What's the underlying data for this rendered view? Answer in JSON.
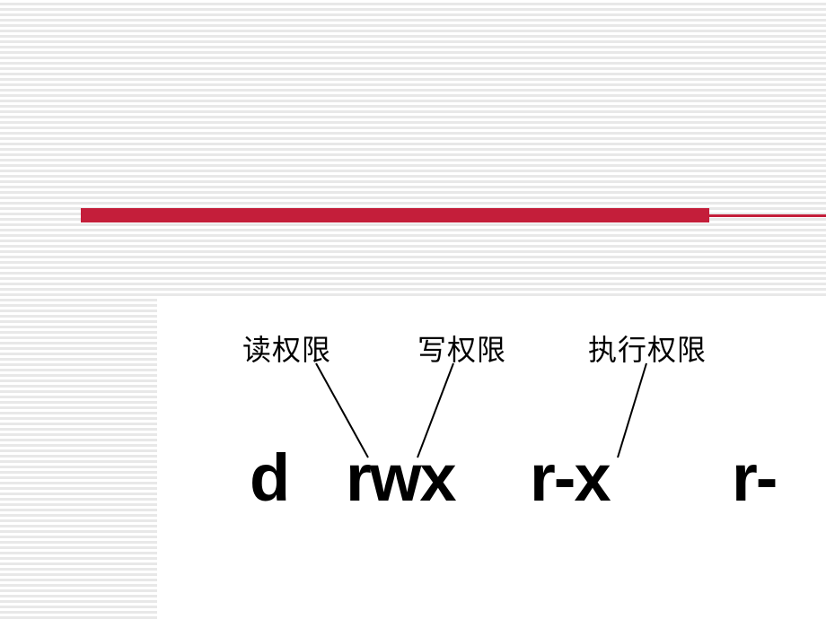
{
  "labels": {
    "read": "读权限",
    "write": "写权限",
    "execute": "执行权限"
  },
  "permissions": {
    "type_char": "d",
    "owner": "rwx",
    "group": "r-x",
    "other_partial": "r-"
  }
}
